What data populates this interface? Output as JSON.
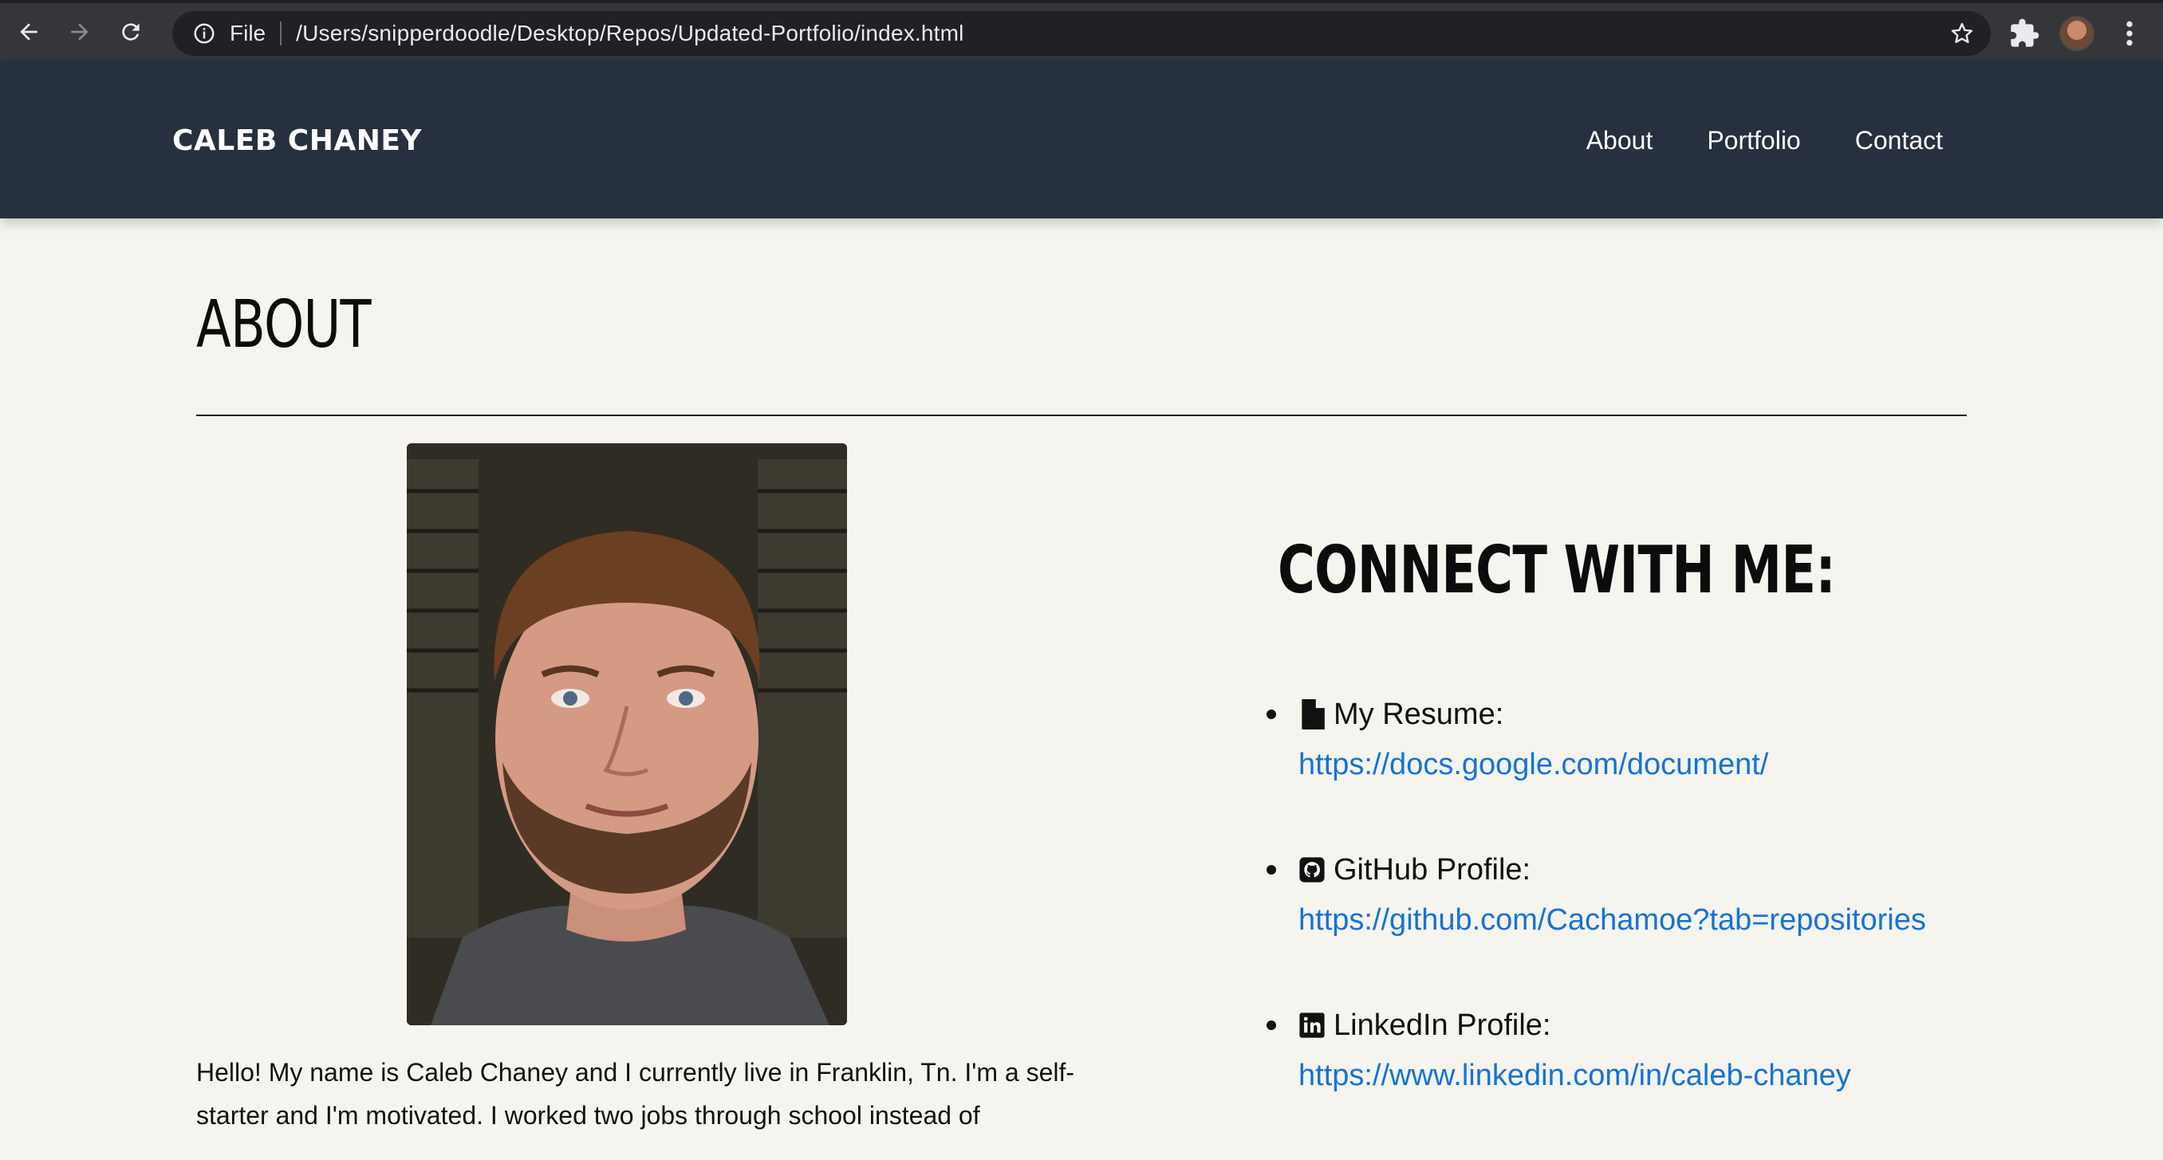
{
  "browser": {
    "file_label": "File",
    "url": "/Users/snipperdoodle/Desktop/Repos/Updated-Portfolio/index.html"
  },
  "header": {
    "brand": "CALEB CHANEY",
    "nav": [
      "About",
      "Portfolio",
      "Contact"
    ]
  },
  "about": {
    "title": "ABOUT",
    "bio": "Hello! My name is Caleb Chaney and I currently live in Franklin, Tn. I'm a self-starter and I'm motivated. I worked two jobs through school instead of"
  },
  "connect": {
    "title": "CONNECT WITH ME:",
    "items": [
      {
        "icon": "file-icon",
        "label": "My Resume:",
        "link": "https://docs.google.com/document/"
      },
      {
        "icon": "github-icon",
        "label": "GitHub Profile:",
        "link": "https://github.com/Cachamoe?tab=repositories"
      },
      {
        "icon": "linkedin-icon",
        "label": "LinkedIn Profile:",
        "link": "https://www.linkedin.com/in/caleb-chaney"
      }
    ]
  },
  "colors": {
    "header_bg": "#27303f",
    "page_bg": "#f5f4ef",
    "link": "#1673d6"
  }
}
